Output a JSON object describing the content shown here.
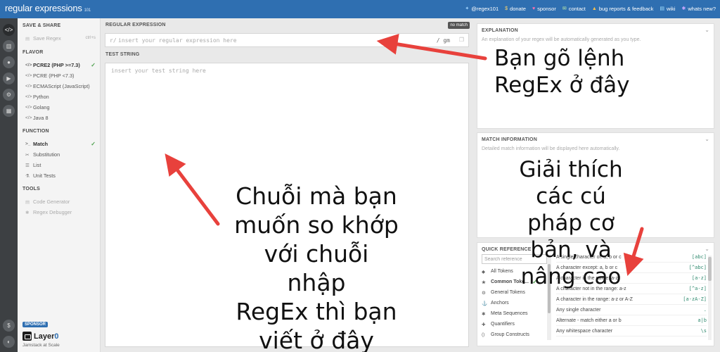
{
  "topbar": {
    "logo": "regular expressions",
    "version": "101",
    "links": [
      {
        "label": "@regex101",
        "icon": "twitter-icon"
      },
      {
        "label": "donate",
        "icon": "dollar-icon"
      },
      {
        "label": "sponsor",
        "icon": "heart-icon"
      },
      {
        "label": "contact",
        "icon": "mail-icon"
      },
      {
        "label": "bug reports & feedback",
        "icon": "warning-icon"
      },
      {
        "label": "wiki",
        "icon": "book-icon"
      },
      {
        "label": "whats new?",
        "icon": "star-icon"
      }
    ]
  },
  "rail": {
    "icons": [
      "regex-editor-icon",
      "library-icon",
      "account-icon",
      "video-icon",
      "settings-icon",
      "community-icon",
      "donate-icon",
      "theme-toggle-icon"
    ]
  },
  "sidebar": {
    "save_share": {
      "title": "SAVE & SHARE",
      "save_label": "Save Regex",
      "save_shortcut": "ctrl+s"
    },
    "flavor": {
      "title": "FLAVOR",
      "items": [
        "PCRE2 (PHP >=7.3)",
        "PCRE (PHP <7.3)",
        "ECMAScript (JavaScript)",
        "Python",
        "Golang",
        "Java 8"
      ],
      "selected": "PCRE2 (PHP >=7.3)"
    },
    "function": {
      "title": "FUNCTION",
      "items": [
        "Match",
        "Substitution",
        "List",
        "Unit Tests"
      ],
      "selected": "Match"
    },
    "tools": {
      "title": "TOOLS",
      "items": [
        "Code Generator",
        "Regex Debugger"
      ]
    },
    "sponsor": {
      "tag": "SPONSOR",
      "brand_a": "Layer",
      "brand_b": "0",
      "tagline": "Jamstack at Scale"
    }
  },
  "main": {
    "regex": {
      "label": "REGULAR EXPRESSION",
      "status": "no match",
      "delimiter": "r/",
      "placeholder": "insert your regular expression here",
      "flags": "/ gm"
    },
    "test": {
      "label": "TEST STRING",
      "placeholder": "insert your test string here"
    }
  },
  "explanation": {
    "title": "EXPLANATION",
    "placeholder": "An explanation of your regex will be automatically generated as you type."
  },
  "match_info": {
    "title": "MATCH INFORMATION",
    "placeholder": "Detailed match information will be displayed here automatically."
  },
  "quick_ref": {
    "title": "QUICK REFERENCE",
    "search_placeholder": "Search reference",
    "categories": [
      {
        "label": "All Tokens",
        "icon": "all-tokens-icon",
        "glyph": "◆"
      },
      {
        "label": "Common Toke...",
        "icon": "star-icon",
        "glyph": "★"
      },
      {
        "label": "General Tokens",
        "icon": "gear-icon",
        "glyph": "⚙"
      },
      {
        "label": "Anchors",
        "icon": "anchor-icon",
        "glyph": "⚓"
      },
      {
        "label": "Meta Sequences",
        "icon": "meta-icon",
        "glyph": "✱"
      },
      {
        "label": "Quantifiers",
        "icon": "quantifier-icon",
        "glyph": "✚"
      },
      {
        "label": "Group Constructs",
        "icon": "group-icon",
        "glyph": "()"
      }
    ],
    "selected_category": "Common Toke...",
    "rows": [
      {
        "desc": "A single character of: a, b or c",
        "token": "[abc]"
      },
      {
        "desc": "A character except: a, b or c",
        "token": "[^abc]"
      },
      {
        "desc": "A character in the range: a-z",
        "token": "[a-z]"
      },
      {
        "desc": "A character not in the range: a-z",
        "token": "[^a-z]"
      },
      {
        "desc": "A character in the range: a-z or A-Z",
        "token": "[a-zA-Z]"
      },
      {
        "desc": "Any single character",
        "token": "."
      },
      {
        "desc": "Alternate - match either a or b",
        "token": "a|b"
      },
      {
        "desc": "Any whitespace character",
        "token": "\\s"
      }
    ]
  },
  "annotations": {
    "regex_note": [
      "Bạn gõ lệnh",
      "RegEx ở đây"
    ],
    "explain_note": [
      "Giải thích các cú",
      "pháp cơ bản, và",
      "nâng cao"
    ],
    "test_note": [
      "Chuỗi mà bạn",
      "muốn so khớp",
      "với chuỗi nhập",
      "RegEx thì bạn",
      "viết ở đây"
    ]
  },
  "colors": {
    "topbar": "#2f6fb1",
    "rail": "#3d4043",
    "annotation_arrow": "#e8413c",
    "check": "#4ca04c"
  }
}
